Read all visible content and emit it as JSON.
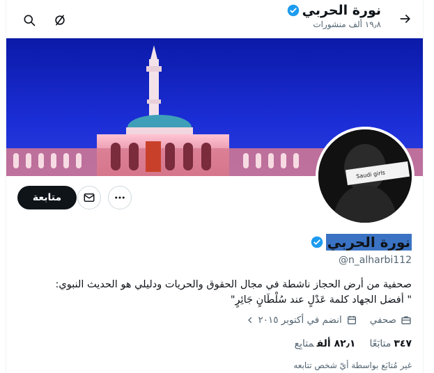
{
  "header": {
    "name": "نورة الحربي",
    "posts_count": "١٩٫٨ ألف منشورات"
  },
  "profile": {
    "display_name": "نورة الحربي",
    "handle": "@n_alharbi112",
    "bio_line1": "صحفية من أرض الحجاز ناشطة في مجال الحقوق والحريات ودليلي هو الحديث النبوي:",
    "bio_line2": "\" أفضل الجهاد كلمة عَدْلٍ عند سُلْطَانٍ جَائِرٍ\"",
    "category": "صحفي",
    "joined": "انضم في أكتوبر ٢٠١٥",
    "avatar_text": "Saudi girls"
  },
  "counts": {
    "following_value": "٣٤٧",
    "following_label": "متابَعًا",
    "followers_value": "٨٢٫١ ألف",
    "followers_label": "متابِع"
  },
  "footer_note": "غير مُتابَع بواسطة أيّ شخص تتابعه",
  "buttons": {
    "follow_label": "متابعة"
  },
  "colors": {
    "verified": "#1d9bf0",
    "follow_bg": "#0f1419",
    "selection": "#3b73c4"
  },
  "icons": [
    "back-arrow-icon",
    "search-icon",
    "hide-icon",
    "verified-icon",
    "mail-icon",
    "more-icon",
    "briefcase-icon",
    "calendar-icon",
    "chevron-icon"
  ]
}
